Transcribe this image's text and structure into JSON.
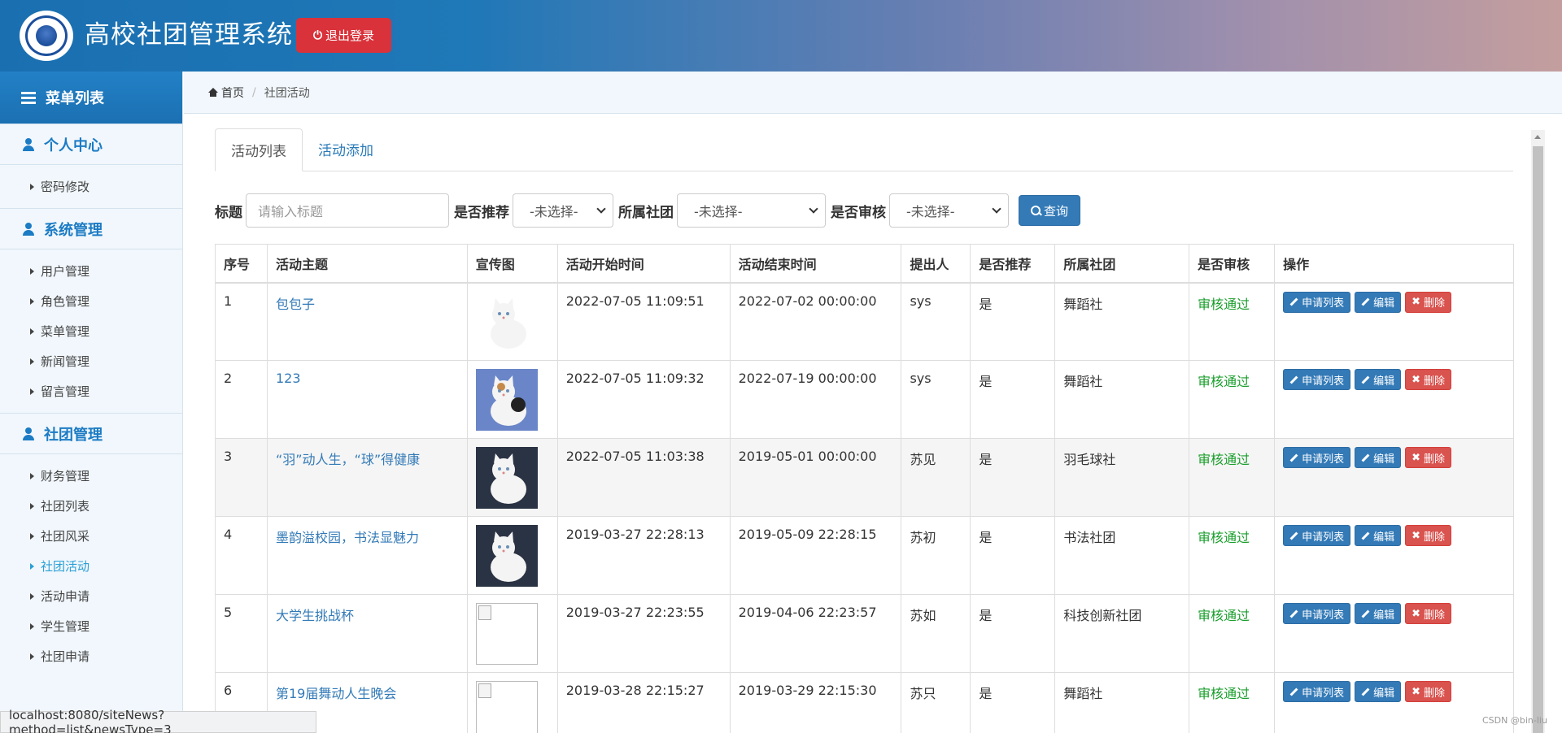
{
  "header": {
    "app_title": "高校社团管理系统",
    "logout_label": "退出登录",
    "logout_icon": "power-icon"
  },
  "sidebar": {
    "menu_title": "菜单列表",
    "groups": [
      {
        "title": "个人中心",
        "items": [
          "密码修改"
        ]
      },
      {
        "title": "系统管理",
        "items": [
          "用户管理",
          "角色管理",
          "菜单管理",
          "新闻管理",
          "留言管理"
        ]
      },
      {
        "title": "社团管理",
        "items": [
          "财务管理",
          "社团列表",
          "社团风采",
          "社团活动",
          "活动申请",
          "学生管理",
          "社团申请"
        ]
      }
    ],
    "active_item": "社团活动"
  },
  "breadcrumb": {
    "home": "首页",
    "current": "社团活动"
  },
  "tabs": [
    "活动列表",
    "活动添加"
  ],
  "filters": {
    "title_label": "标题",
    "title_placeholder": "请输入标题",
    "recommend_label": "是否推荐",
    "recommend_value": "-未选择-",
    "club_label": "所属社团",
    "club_value": "-未选择-",
    "audit_label": "是否审核",
    "audit_value": "-未选择-",
    "search_label": "查询"
  },
  "table": {
    "headers": [
      "序号",
      "活动主题",
      "宣传图",
      "活动开始时间",
      "活动结束时间",
      "提出人",
      "是否推荐",
      "所属社团",
      "是否审核",
      "操作"
    ],
    "rows": [
      {
        "no": "1",
        "topic": "包包子",
        "start": "2022-07-05 11:09:51",
        "end": "2022-07-02 00:00:00",
        "by": "sys",
        "rec": "是",
        "club": "舞蹈社",
        "audit": "审核通过"
      },
      {
        "no": "2",
        "topic": "123",
        "start": "2022-07-05 11:09:32",
        "end": "2022-07-19 00:00:00",
        "by": "sys",
        "rec": "是",
        "club": "舞蹈社",
        "audit": "审核通过"
      },
      {
        "no": "3",
        "topic": "“羽”动人生，“球”得健康",
        "start": "2022-07-05 11:03:38",
        "end": "2019-05-01 00:00:00",
        "by": "苏见",
        "rec": "是",
        "club": "羽毛球社",
        "audit": "审核通过"
      },
      {
        "no": "4",
        "topic": "墨韵溢校园，书法显魅力",
        "start": "2019-03-27 22:28:13",
        "end": "2019-05-09 22:28:15",
        "by": "苏初",
        "rec": "是",
        "club": "书法社团",
        "audit": "审核通过"
      },
      {
        "no": "5",
        "topic": "大学生挑战杯",
        "start": "2019-03-27 22:23:55",
        "end": "2019-04-06 22:23:57",
        "by": "苏如",
        "rec": "是",
        "club": "科技创新社团",
        "audit": "审核通过"
      },
      {
        "no": "6",
        "topic": "第19届舞动人生晚会",
        "start": "2019-03-28 22:15:27",
        "end": "2019-03-29 22:15:30",
        "by": "苏只",
        "rec": "是",
        "club": "舞蹈社",
        "audit": "审核通过"
      }
    ],
    "op_labels": {
      "apply_list": "申请列表",
      "edit": "编辑",
      "delete": "删除"
    }
  },
  "statusbar": {
    "url": "localhost:8080/siteNews?method=list&newsType=3"
  },
  "watermark": "CSDN @bin-liu"
}
